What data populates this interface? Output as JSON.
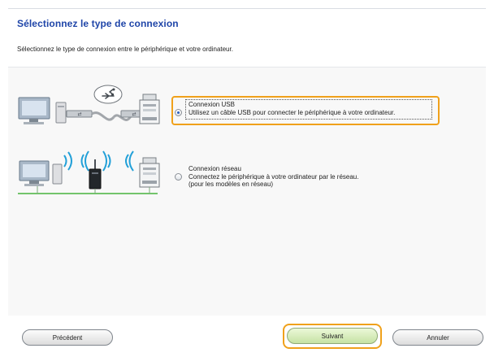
{
  "page": {
    "title": "Sélectionnez le type de connexion",
    "subtitle": "Sélectionnez le type de connexion entre le périphérique et votre ordinateur."
  },
  "options": [
    {
      "id": "usb",
      "selected": true,
      "label": "Connexion USB",
      "description": "Utilisez un câble USB pour connecter le périphérique à votre ordinateur."
    },
    {
      "id": "network",
      "selected": false,
      "label": "Connexion réseau",
      "description_line1": "Connectez le périphérique à votre ordinateur par le réseau.",
      "description_line2": "(pour les modèles en réseau)"
    }
  ],
  "buttons": {
    "back": "Précédent",
    "next": "Suivant",
    "cancel": "Annuler"
  },
  "icons": {
    "usb": "usb-icon",
    "computer": "computer-icon",
    "printer": "printer-icon",
    "router": "router-icon"
  },
  "colors": {
    "title": "#1f45a8",
    "highlight": "#f0a11b",
    "next_button": "#c6e2a4"
  }
}
